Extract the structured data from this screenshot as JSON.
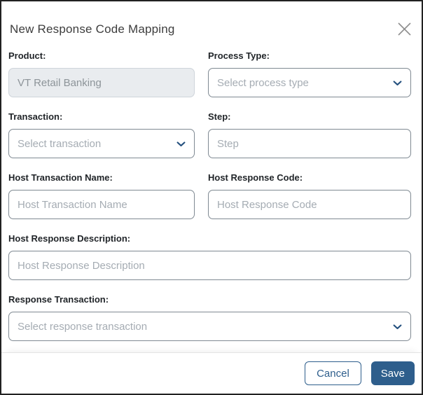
{
  "modal": {
    "title": "New Response Code Mapping"
  },
  "fields": {
    "product": {
      "label": "Product:",
      "value": "VT Retail Banking",
      "disabled": true
    },
    "process_type": {
      "label": "Process Type:",
      "placeholder": "Select process type"
    },
    "transaction": {
      "label": "Transaction:",
      "placeholder": "Select transaction"
    },
    "step": {
      "label": "Step:",
      "placeholder": "Step"
    },
    "host_transaction_name": {
      "label": "Host Transaction Name:",
      "placeholder": "Host Transaction Name"
    },
    "host_response_code": {
      "label": "Host Response Code:",
      "placeholder": "Host Response Code"
    },
    "host_response_description": {
      "label": "Host Response Description:",
      "placeholder": "Host Response Description"
    },
    "response_transaction": {
      "label": "Response Transaction:",
      "placeholder": "Select response transaction"
    }
  },
  "footer": {
    "cancel_label": "Cancel",
    "save_label": "Save"
  },
  "icons": {
    "close": "close-icon",
    "chevron": "chevron-down-icon"
  },
  "colors": {
    "accent": "#2e5e8c",
    "chevron": "#24507e",
    "modal_border": "#222222",
    "input_border": "#7f8992",
    "disabled_bg": "#e9ecef",
    "placeholder": "#a5acb3",
    "label_text": "#212529",
    "title_text": "#3d3d3d"
  }
}
